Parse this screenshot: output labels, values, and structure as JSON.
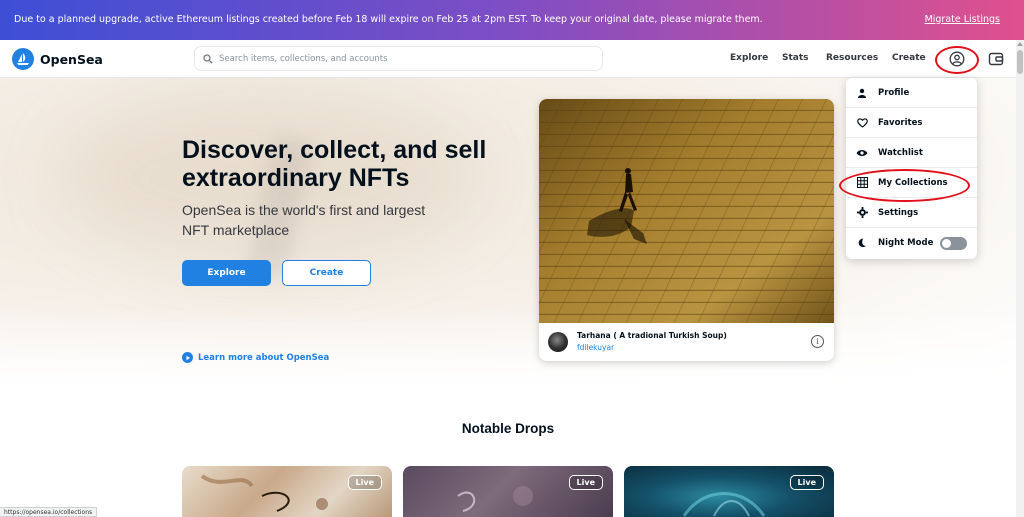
{
  "banner": {
    "text": "Due to a planned upgrade, active Ethereum listings created before Feb 18 will expire on Feb 25 at 2pm EST. To keep your original date, please migrate them.",
    "link": "Migrate Listings"
  },
  "nav": {
    "brand": "OpenSea",
    "search_placeholder": "Search items, collections, and accounts",
    "links": [
      "Explore",
      "Stats",
      "Resources",
      "Create"
    ]
  },
  "hero": {
    "title": "Discover, collect, and sell extraordinary NFTs",
    "subtitle": "OpenSea is the world's first and largest NFT marketplace",
    "explore_label": "Explore",
    "create_label": "Create",
    "learn_more": "Learn more about OpenSea"
  },
  "featured": {
    "title": "Tarhana ( A tradional Turkish Soup)",
    "creator": "fdilekuyar",
    "info_icon": "info-icon"
  },
  "account_menu": {
    "items": [
      {
        "label": "Profile",
        "icon": "person-icon"
      },
      {
        "label": "Favorites",
        "icon": "heart-icon"
      },
      {
        "label": "Watchlist",
        "icon": "eye-icon"
      },
      {
        "label": "My Collections",
        "icon": "grid-icon"
      },
      {
        "label": "Settings",
        "icon": "gear-icon"
      },
      {
        "label": "Night Mode",
        "icon": "moon-icon",
        "toggle": false
      }
    ]
  },
  "notable_drops": {
    "title": "Notable Drops",
    "badges": [
      "Live",
      "Live",
      "Live"
    ]
  },
  "status_bar": {
    "url": "https://opensea.io/collections"
  },
  "colors": {
    "accent": "#2081e2",
    "highlight_ring": "#e0101a",
    "banner_start": "#3d4fd6",
    "banner_end": "#e0508d"
  }
}
